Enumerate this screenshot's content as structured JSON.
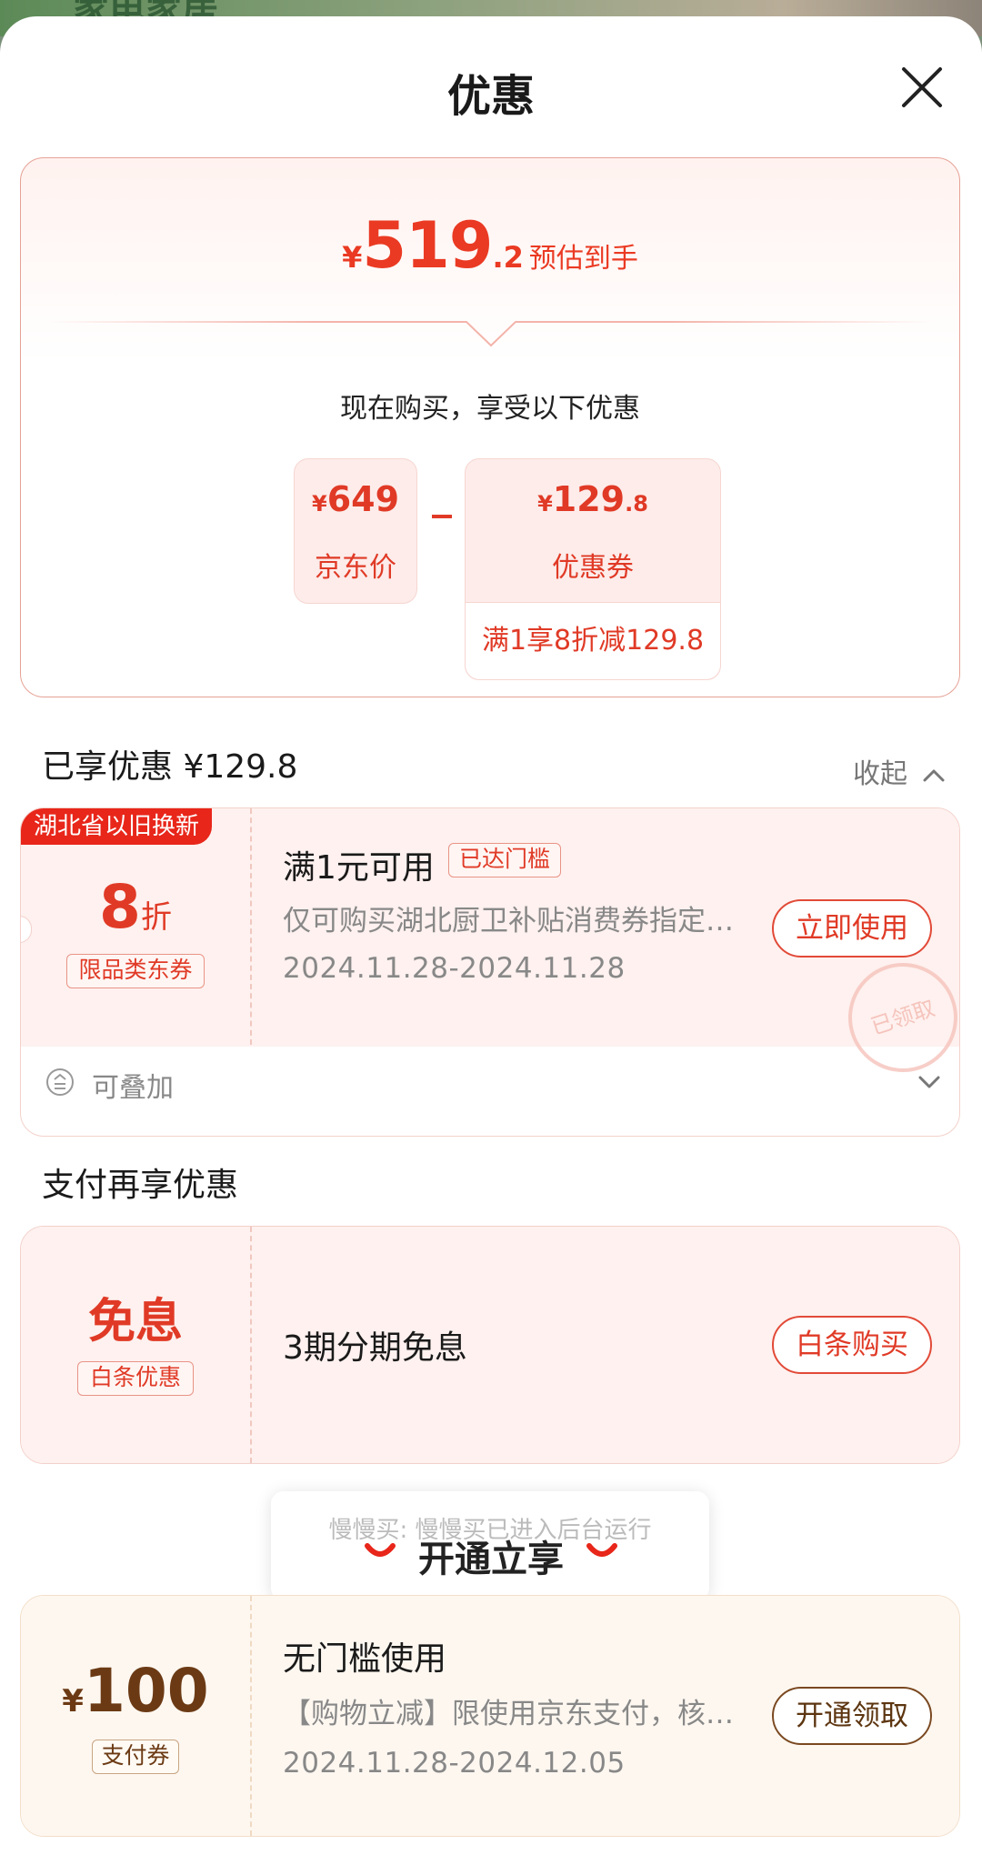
{
  "background": {
    "text": "家电家居"
  },
  "header": {
    "title": "优惠"
  },
  "summary": {
    "currency": "¥",
    "price_int": "519",
    "price_dec": ".2",
    "price_label": "预估到手",
    "buy_now_text": "现在购买，享受以下优惠",
    "jd_price": {
      "currency": "¥",
      "amount": "649",
      "label": "京东价"
    },
    "minus": "-",
    "coupon": {
      "currency": "¥",
      "amount_int": "129",
      "amount_dec": ".8",
      "label": "优惠券",
      "note": "满1享8折减129.8"
    }
  },
  "enjoyed": {
    "title": "已享优惠 ¥129.8",
    "collapse_label": "收起"
  },
  "coupon1": {
    "tag": "湖北省以旧换新",
    "discount": "8",
    "discount_unit": "折",
    "type_label": "限品类东券",
    "title": "满1元可用",
    "threshold_badge": "已达门槛",
    "desc": "仅可购买湖北厨卫补贴消费券指定商品",
    "date": "2024.11.28-2024.11.28",
    "button": "立即使用",
    "stamp": "已领取",
    "stackable": "可叠加"
  },
  "pay_section": {
    "title": "支付再享优惠"
  },
  "coupon2": {
    "big": "免息",
    "type_label": "白条优惠",
    "title": "3期分期免息",
    "button": "白条购买"
  },
  "toast": {
    "message": "慢慢买: 慢慢买已进入后台运行"
  },
  "open_now": "开通立享",
  "coupon3": {
    "currency": "¥",
    "amount": "100",
    "type_label": "支付券",
    "title": "无门槛使用",
    "desc": "【购物立减】限使用京东支付，核销后立减",
    "date": "2024.11.28-2024.12.05",
    "button": "开通领取"
  },
  "colors": {
    "accent": "#e03a26",
    "brand_red": "#e8261a",
    "gold_text": "#5c3510"
  }
}
